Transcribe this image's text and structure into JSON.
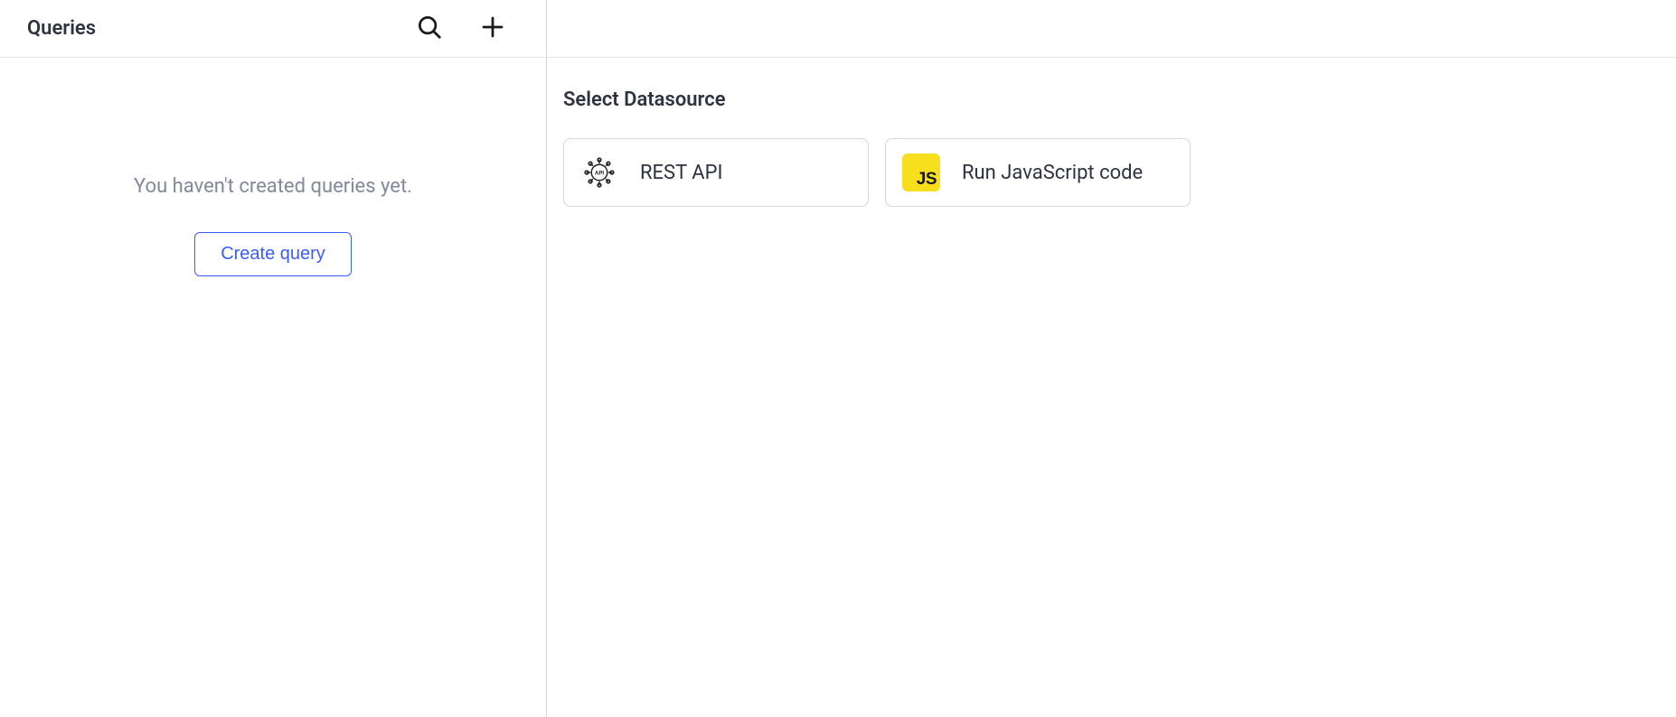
{
  "sidebar": {
    "title": "Queries",
    "empty_message": "You haven't created queries yet.",
    "create_button_label": "Create query"
  },
  "main": {
    "title": "Select Datasource",
    "datasources": [
      {
        "icon": "api-icon",
        "label": "REST API"
      },
      {
        "icon": "js-icon",
        "label": "Run JavaScript code",
        "badge_text": "JS"
      }
    ]
  }
}
